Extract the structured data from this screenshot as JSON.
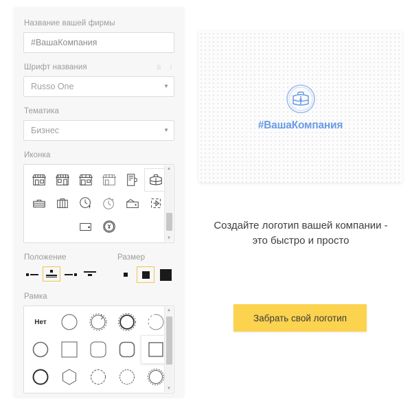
{
  "colors": {
    "panel_bg": "#f7f7f7",
    "accent_orange": "#f2c44a",
    "cta_yellow": "#fbd34f",
    "logo_blue": "#6a9be8",
    "border_gray": "#dcdcdc"
  },
  "form": {
    "company_name": {
      "label": "Название вашей фирмы",
      "value": "#ВашаКомпания",
      "placeholder": "#ВашаКомпания"
    },
    "font": {
      "label": "Шрифт названия",
      "value": "Russo One",
      "bold_toggle": "B",
      "italic_toggle": "I"
    },
    "theme": {
      "label": "Тематика",
      "value": "Бизнес"
    },
    "icon": {
      "label": "Иконка",
      "selected_index": 5,
      "items": [
        {
          "name": "storefront-awning-icon"
        },
        {
          "name": "storefront-two-windows-icon"
        },
        {
          "name": "storefront-door-icon"
        },
        {
          "name": "storefront-plain-icon"
        },
        {
          "name": "atm-machine-icon"
        },
        {
          "name": "briefcase-open-icon"
        },
        {
          "name": "suitcase-striped-icon"
        },
        {
          "name": "suitcase-lines-icon"
        },
        {
          "name": "clock-money-icon"
        },
        {
          "name": "stopwatch-icon"
        },
        {
          "name": "wallet-card-icon"
        },
        {
          "name": "money-transfer-icon"
        },
        {
          "name": "wallet-coin-icon"
        },
        {
          "name": "yen-clock-icon"
        }
      ]
    },
    "position": {
      "label": "Положение",
      "selected_index": 1,
      "options": [
        {
          "name": "position-icon-left"
        },
        {
          "name": "position-icon-above"
        },
        {
          "name": "position-icon-right"
        },
        {
          "name": "position-icon-top"
        }
      ]
    },
    "size": {
      "label": "Размер",
      "selected_index": 1,
      "options": [
        {
          "name": "size-small"
        },
        {
          "name": "size-medium"
        },
        {
          "name": "size-large"
        }
      ]
    },
    "frame": {
      "label": "Рамка",
      "none_label": "Нет",
      "selected_index": 9,
      "items": [
        {
          "name": "frame-none"
        },
        {
          "name": "frame-circle-thin"
        },
        {
          "name": "frame-circle-dashed-arrow"
        },
        {
          "name": "frame-circle-thick-dashed"
        },
        {
          "name": "frame-circle-broken"
        },
        {
          "name": "frame-circle-shadow"
        },
        {
          "name": "frame-square"
        },
        {
          "name": "frame-rounded-square"
        },
        {
          "name": "frame-rounded-square-thick"
        },
        {
          "name": "frame-square-selected"
        },
        {
          "name": "frame-circle-bold"
        },
        {
          "name": "frame-hexagon"
        },
        {
          "name": "frame-scallop-small"
        },
        {
          "name": "frame-scallop-medium"
        },
        {
          "name": "frame-scallop-large"
        }
      ]
    }
  },
  "preview": {
    "logo_text": "#ВашаКомпания",
    "icon_name": "briefcase-circle-icon"
  },
  "promo": {
    "headline_line1": "Создайте логотип вашей компании -",
    "headline_line2": "это быстро и просто",
    "cta_label": "Забрать свой логотип"
  }
}
